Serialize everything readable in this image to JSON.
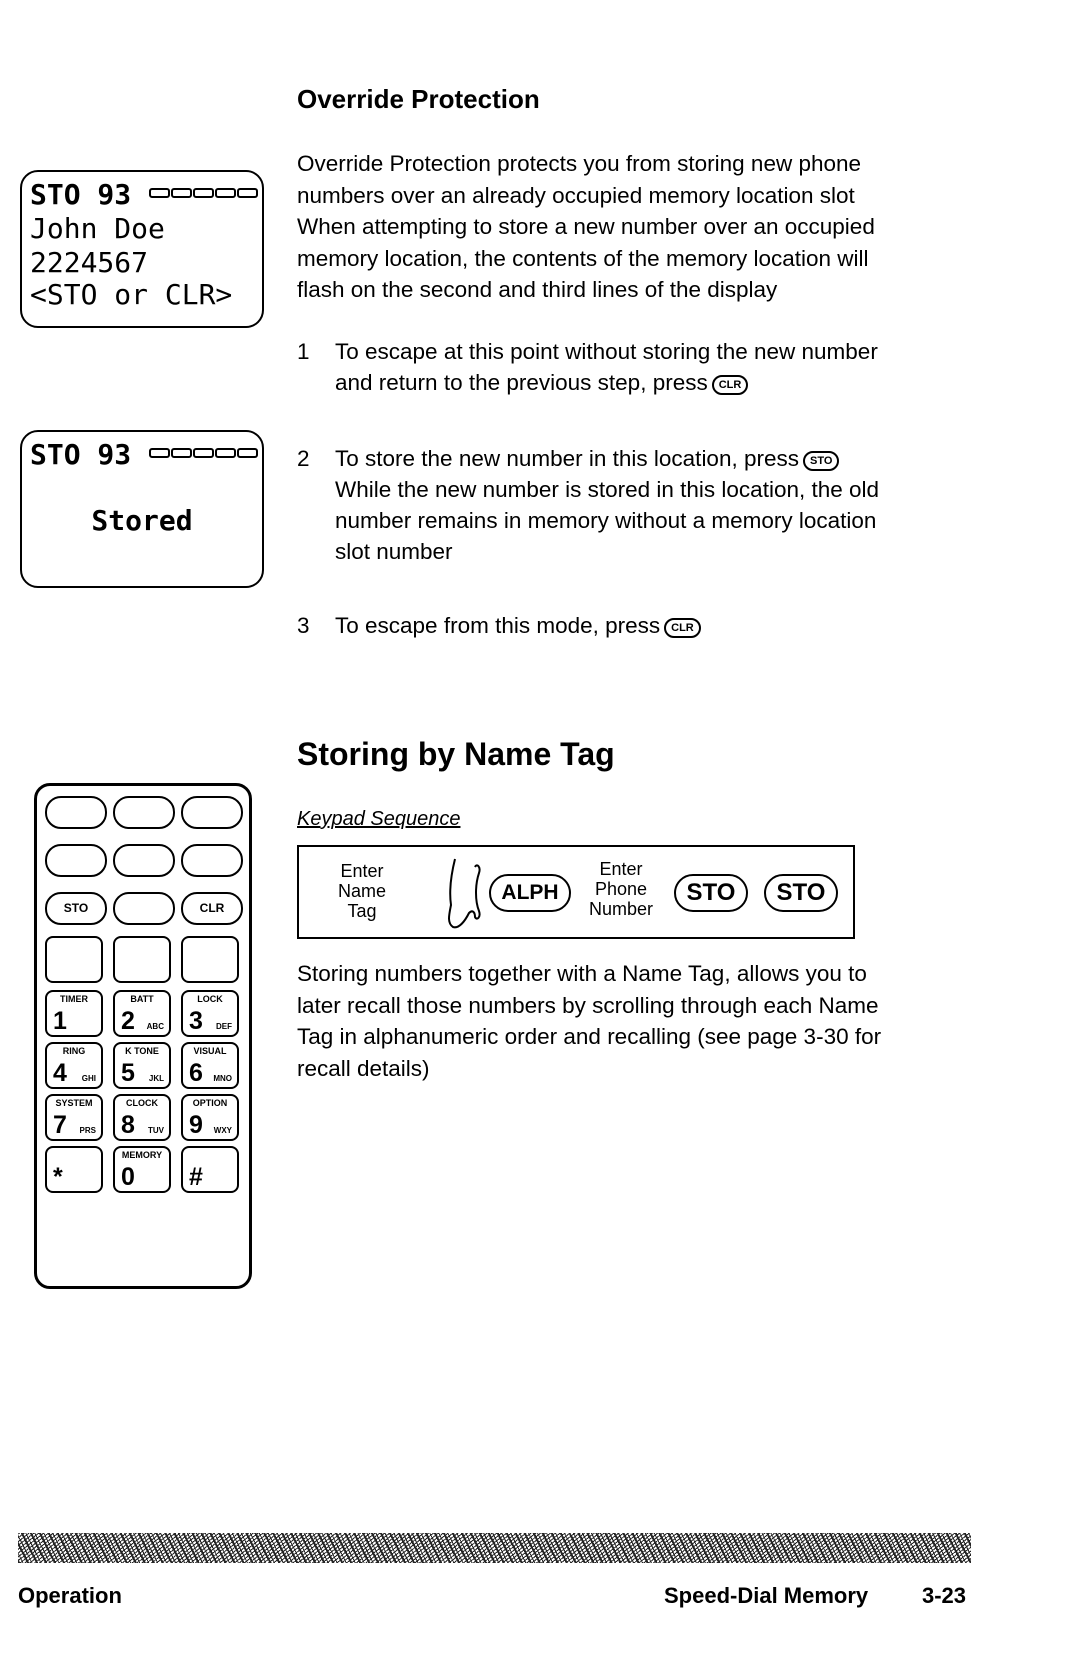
{
  "override": {
    "heading": "Override Protection",
    "paragraph": [
      "Override Protection protects you from storing new phone",
      "numbers over an already occupied memory location slot",
      "When attempting to store a new number over an occupied",
      "memory location, the contents of the memory location will",
      "flash on the second and third lines of the display"
    ],
    "steps": [
      {
        "num": "1",
        "lines": [
          "To escape at this point without storing the new number",
          "and return to the previous step, press"
        ],
        "key": "CLR"
      },
      {
        "num": "2",
        "lines": [
          "To store the new number in this location, press"
        ],
        "key": "STO",
        "extra": [
          "While the new number is stored in this location, the old",
          "number remains in memory without a memory location",
          "slot number"
        ]
      },
      {
        "num": "3",
        "lines": [
          "To escape from this mode, press"
        ],
        "key": "CLR"
      }
    ]
  },
  "displays": {
    "first": {
      "line1": "STO 93",
      "line2": "John Doe",
      "line3": "2224567",
      "line4": "<STO or CLR>"
    },
    "second": {
      "line1": "STO 93",
      "line2": "Stored"
    }
  },
  "name_tag": {
    "heading": "Storing by Name Tag",
    "keypad_sequence_label": "Keypad Sequence",
    "sequence": {
      "enter_name_tag": [
        "Enter",
        "Name",
        "Tag"
      ],
      "alph_key": "ALPH",
      "enter_phone_number": [
        "Enter",
        "Phone",
        "Number"
      ],
      "sto_key_1": "STO",
      "sto_key_2": "STO"
    },
    "paragraph": [
      "Storing numbers together with a Name Tag, allows you to",
      "later recall those numbers by scrolling through each Name",
      "Tag in alphanumeric order and recalling (see page 3-30 for",
      "recall details)"
    ]
  },
  "phone": {
    "soft_keys": [
      "STO",
      "",
      "CLR"
    ],
    "keys": [
      {
        "fn": "TIMER",
        "digit": "1",
        "letters": ""
      },
      {
        "fn": "BATT",
        "digit": "2",
        "letters": "ABC"
      },
      {
        "fn": "LOCK",
        "digit": "3",
        "letters": "DEF"
      },
      {
        "fn": "RING",
        "digit": "4",
        "letters": "GHI"
      },
      {
        "fn": "K TONE",
        "digit": "5",
        "letters": "JKL"
      },
      {
        "fn": "VISUAL",
        "digit": "6",
        "letters": "MNO"
      },
      {
        "fn": "SYSTEM",
        "digit": "7",
        "letters": "PRS"
      },
      {
        "fn": "CLOCK",
        "digit": "8",
        "letters": "TUV"
      },
      {
        "fn": "OPTION",
        "digit": "9",
        "letters": "WXY"
      },
      {
        "fn": "",
        "digit": "*",
        "letters": ""
      },
      {
        "fn": "MEMORY",
        "digit": "0",
        "letters": ""
      },
      {
        "fn": "",
        "digit": "#",
        "letters": ""
      }
    ]
  },
  "footer": {
    "left": "Operation",
    "section": "Speed-Dial Memory",
    "page": "3-23"
  }
}
